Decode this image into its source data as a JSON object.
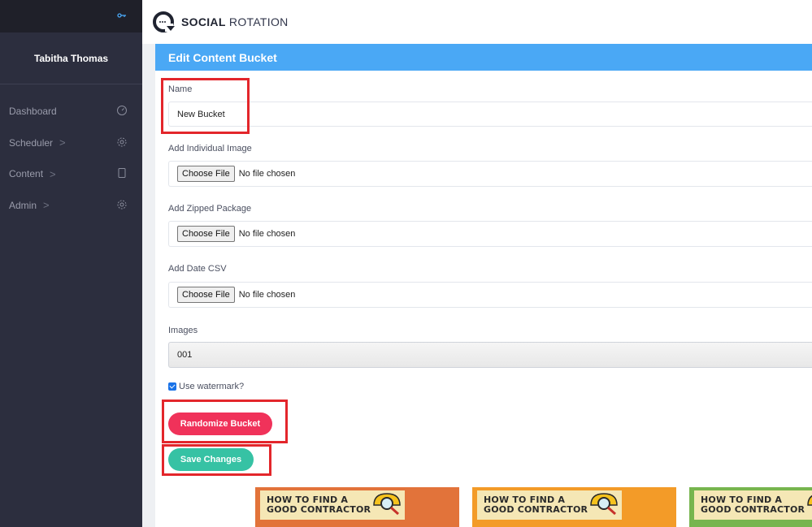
{
  "sidebar": {
    "user_name": "Tabitha Thomas",
    "items": [
      {
        "label": "Dashboard",
        "icon": "gauge-icon",
        "has_chevron": false
      },
      {
        "label": "Scheduler",
        "icon": "gear-icon",
        "has_chevron": true
      },
      {
        "label": "Content",
        "icon": "tablet-icon",
        "has_chevron": true
      },
      {
        "label": "Admin",
        "icon": "gear-icon",
        "has_chevron": true
      }
    ],
    "chevron_glyph": ">"
  },
  "header": {
    "brand_bold": "SOCIAL",
    "brand_light": "ROTATION"
  },
  "panel": {
    "title": "Edit Content Bucket",
    "name_label": "Name",
    "name_value": "New Bucket",
    "individual_image_label": "Add Individual Image",
    "zipped_package_label": "Add Zipped Package",
    "date_csv_label": "Add Date CSV",
    "choose_file_label": "Choose File",
    "no_file_text": "No file chosen",
    "images_label": "Images",
    "images_selected": "001",
    "watermark_label": "Use watermark?",
    "watermark_checked": true,
    "randomize_label": "Randomize Bucket",
    "save_label": "Save Changes"
  },
  "thumbnails": [
    {
      "line1": "HOW TO FIND A",
      "line2": "GOOD CONTRACTOR",
      "bg": "#e2733a"
    },
    {
      "line1": "HOW TO FIND A",
      "line2": "GOOD CONTRACTOR",
      "bg": "#f39b28"
    },
    {
      "line1": "HOW TO FIND A",
      "line2": "GOOD CONTRACTOR",
      "bg": "#77b54e"
    }
  ],
  "colors": {
    "sidebar_bg": "#2c2e3e",
    "panel_header": "#4aa8f5",
    "randomize": "#f0325a",
    "save": "#36c2a4",
    "highlight": "#e3262b"
  }
}
